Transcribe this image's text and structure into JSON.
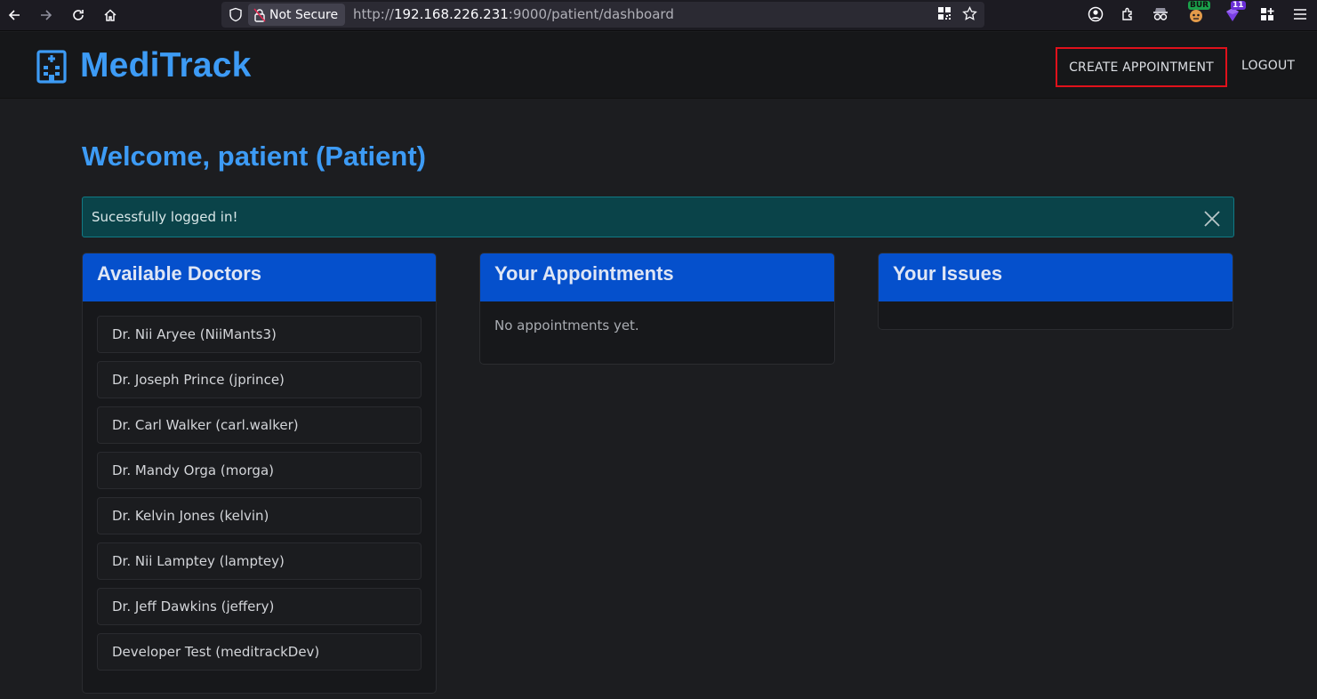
{
  "browser": {
    "not_secure_label": "Not Secure",
    "url_scheme": "http://",
    "url_host": "192.168.226.231",
    "url_rest": ":9000/patient/dashboard",
    "extension_badge_1": "BUR",
    "extension_badge_2": "11"
  },
  "header": {
    "brand": "MediTrack",
    "nav_create": "CREATE APPOINTMENT",
    "nav_logout": "LOGOUT",
    "highlight_color": "#e0111b"
  },
  "main": {
    "welcome": "Welcome, patient (Patient)",
    "alert_text": "Sucessfully logged in!",
    "doctors_card": {
      "title": "Available Doctors",
      "items": [
        "Dr. Nii Aryee (NiiMants3)",
        "Dr. Joseph Prince (jprince)",
        "Dr. Carl Walker (carl.walker)",
        "Dr. Mandy Orga (morga)",
        "Dr. Kelvin Jones (kelvin)",
        "Dr. Nii Lamptey (lamptey)",
        "Dr. Jeff Dawkins (jeffery)",
        "Developer Test (meditrackDev)"
      ]
    },
    "appointments_card": {
      "title": "Your Appointments",
      "empty_text": "No appointments yet."
    },
    "issues_card": {
      "title": "Your Issues"
    }
  },
  "colors": {
    "brand_blue": "#3d9bf5",
    "card_header": "#0550cc",
    "alert_bg": "#0a4349"
  }
}
